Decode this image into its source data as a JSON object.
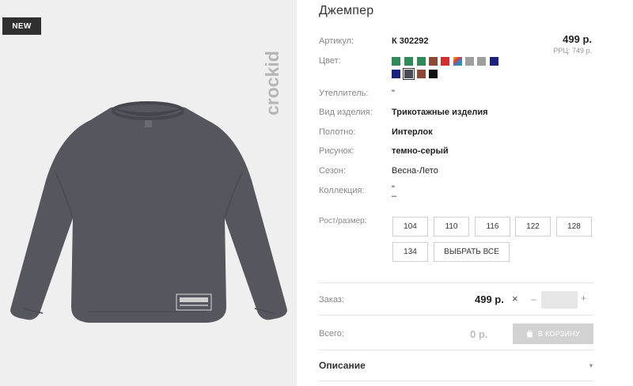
{
  "badge": "NEW",
  "brand": "crockid",
  "product": {
    "title": "Джемпер"
  },
  "price": {
    "main": "499 р.",
    "rrp": "РРЦ: 749 р."
  },
  "fields": [
    {
      "label": "Артикул:",
      "value": "К 302292",
      "bold": true
    },
    {
      "label": "Цвет:",
      "value": "",
      "bold": false
    },
    {
      "label": "Утеплитель:",
      "value": "\"",
      "bold": false
    },
    {
      "label": "Вид изделия:",
      "value": "Трикотажные изделия",
      "bold": true
    },
    {
      "label": "Полотно:",
      "value": "Интерлок",
      "bold": true
    },
    {
      "label": "Рисунок:",
      "value": "темно-серый",
      "bold": true
    },
    {
      "label": "Сезон:",
      "value": "Весна-Лето",
      "bold": false
    },
    {
      "label": "Коллекция:",
      "value": "\"\n–",
      "bold": false
    }
  ],
  "colors": [
    "#2e8b57",
    "#2e8b57",
    "#2e8b57",
    "#8b4a36",
    "#d32f2f",
    "multi",
    "#9e9e9e",
    "#9e9e9e",
    "#1a237e",
    "#1a237e",
    "#4a4a55",
    "#8b4a36",
    "#111111"
  ],
  "selected_color_index": 10,
  "size_label": "Рост/размер:",
  "sizes": [
    "104",
    "110",
    "116",
    "122",
    "128",
    "134"
  ],
  "select_all": "ВЫБРАТЬ ВСЕ",
  "order": {
    "label": "Заказ:",
    "price": "499 р.",
    "times": "×",
    "minus": "–",
    "plus": "+",
    "quantity": ""
  },
  "total": {
    "label": "Всего:",
    "price": "0 р.",
    "cart_button": "В КОРЗИНУ"
  },
  "description": {
    "label": "Описание",
    "arrow": "▼"
  },
  "icons": {
    "cart": "bag-icon",
    "collapse": "chevron-down-icon"
  }
}
